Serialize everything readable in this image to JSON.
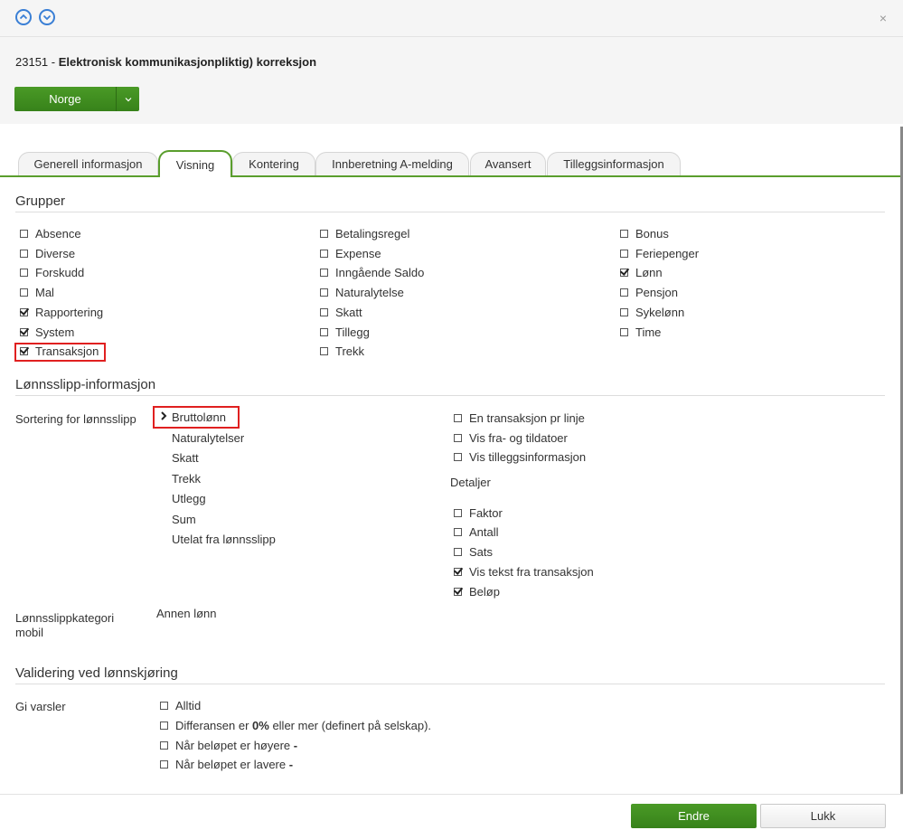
{
  "header": {
    "close_label": "×"
  },
  "title": {
    "code": "23151 - ",
    "name": "Elektronisk kommunikasjonpliktig) korreksjon"
  },
  "country_button": {
    "label": "Norge"
  },
  "tabs": [
    {
      "label": "Generell informasjon"
    },
    {
      "label": "Visning"
    },
    {
      "label": "Kontering"
    },
    {
      "label": "Innberetning A-melding"
    },
    {
      "label": "Avansert"
    },
    {
      "label": "Tilleggsinformasjon"
    }
  ],
  "grupper": {
    "title": "Grupper",
    "col1": [
      {
        "label": "Absence",
        "checked": false
      },
      {
        "label": "Diverse",
        "checked": false
      },
      {
        "label": "Forskudd",
        "checked": false
      },
      {
        "label": "Mal",
        "checked": false
      },
      {
        "label": "Rapportering",
        "checked": true
      },
      {
        "label": "System",
        "checked": true
      },
      {
        "label": "Transaksjon",
        "checked": true
      }
    ],
    "col2": [
      {
        "label": "Betalingsregel",
        "checked": false
      },
      {
        "label": "Expense",
        "checked": false
      },
      {
        "label": "Inngående Saldo",
        "checked": false
      },
      {
        "label": "Naturalytelse",
        "checked": false
      },
      {
        "label": "Skatt",
        "checked": false
      },
      {
        "label": "Tillegg",
        "checked": false
      },
      {
        "label": "Trekk",
        "checked": false
      }
    ],
    "col3": [
      {
        "label": "Bonus",
        "checked": false
      },
      {
        "label": "Feriepenger",
        "checked": false
      },
      {
        "label": "Lønn",
        "checked": true
      },
      {
        "label": "Pensjon",
        "checked": false
      },
      {
        "label": "Sykelønn",
        "checked": false
      },
      {
        "label": "Time",
        "checked": false
      }
    ]
  },
  "lonnsslipp": {
    "title": "Lønnsslipp-informasjon",
    "sort_label": "Sortering for lønnsslipp",
    "sort_items": [
      "Bruttolønn",
      "Naturalytelser",
      "Skatt",
      "Trekk",
      "Utlegg",
      "Sum",
      "Utelat fra lønnsslipp"
    ],
    "options": [
      {
        "label": "En transaksjon pr linje",
        "checked": false
      },
      {
        "label": "Vis fra- og tildatoer",
        "checked": false
      },
      {
        "label": "Vis tilleggsinformasjon",
        "checked": false
      }
    ],
    "detaljer_label": "Detaljer",
    "detaljer": [
      {
        "label": "Faktor",
        "checked": false
      },
      {
        "label": "Antall",
        "checked": false
      },
      {
        "label": "Sats",
        "checked": false
      },
      {
        "label": "Vis tekst fra transaksjon",
        "checked": true
      },
      {
        "label": "Beløp",
        "checked": true
      }
    ],
    "kategori_label_line1": "Lønnsslippkategori",
    "kategori_label_line2": "mobil",
    "kategori_value": "Annen lønn"
  },
  "validering": {
    "title": "Validering ved lønnskjøring",
    "gi_varsler_label": "Gi varsler",
    "alltid": "Alltid",
    "diff_prefix": "Differansen er ",
    "diff_value": "0%",
    "diff_suffix": " eller mer (definert på selskap).",
    "hoyere_label": "Når beløpet er høyere ",
    "hoyere_value": "-",
    "lavere_label": "Når beløpet er lavere ",
    "lavere_value": "-"
  },
  "footer": {
    "edit_label": "Endre",
    "close_label": "Lukk"
  }
}
